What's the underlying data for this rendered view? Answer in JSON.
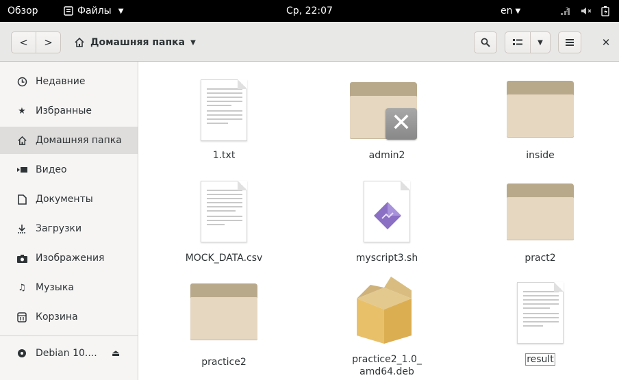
{
  "topbar": {
    "activities": "Обзор",
    "app_name": "Файлы",
    "clock": "Ср, 22:07",
    "language": "en"
  },
  "header": {
    "path_label": "Домашняя папка"
  },
  "sidebar": {
    "items": [
      {
        "label": "Недавние",
        "icon": "clock-icon"
      },
      {
        "label": "Избранные",
        "icon": "star-icon"
      },
      {
        "label": "Домашняя папка",
        "icon": "home-icon"
      },
      {
        "label": "Видео",
        "icon": "video-icon"
      },
      {
        "label": "Документы",
        "icon": "document-icon"
      },
      {
        "label": "Загрузки",
        "icon": "download-icon"
      },
      {
        "label": "Изображения",
        "icon": "camera-icon"
      },
      {
        "label": "Музыка",
        "icon": "music-icon"
      },
      {
        "label": "Корзина",
        "icon": "trash-icon"
      }
    ],
    "device": {
      "label": "Debian 10....",
      "icon": "disc-icon"
    }
  },
  "files": [
    {
      "name": "1.txt",
      "kind": "text"
    },
    {
      "name": "admin2",
      "kind": "folder-locked"
    },
    {
      "name": "inside",
      "kind": "folder"
    },
    {
      "name": "MOCK_DATA.csv",
      "kind": "text"
    },
    {
      "name": "myscript3.sh",
      "kind": "script"
    },
    {
      "name": "pract2",
      "kind": "folder"
    },
    {
      "name": "practice2",
      "kind": "folder"
    },
    {
      "name": "practice2_1.0_",
      "name_line2": "amd64.deb",
      "kind": "package"
    },
    {
      "name": "result",
      "kind": "text"
    }
  ],
  "colors": {
    "topbar_bg": "#000000",
    "headerbar_bg": "#e8e8e7",
    "sidebar_bg": "#f6f5f4",
    "sidebar_active": "#dedddb",
    "folder_front": "#e6d7c0",
    "folder_back": "#b9a98b"
  }
}
